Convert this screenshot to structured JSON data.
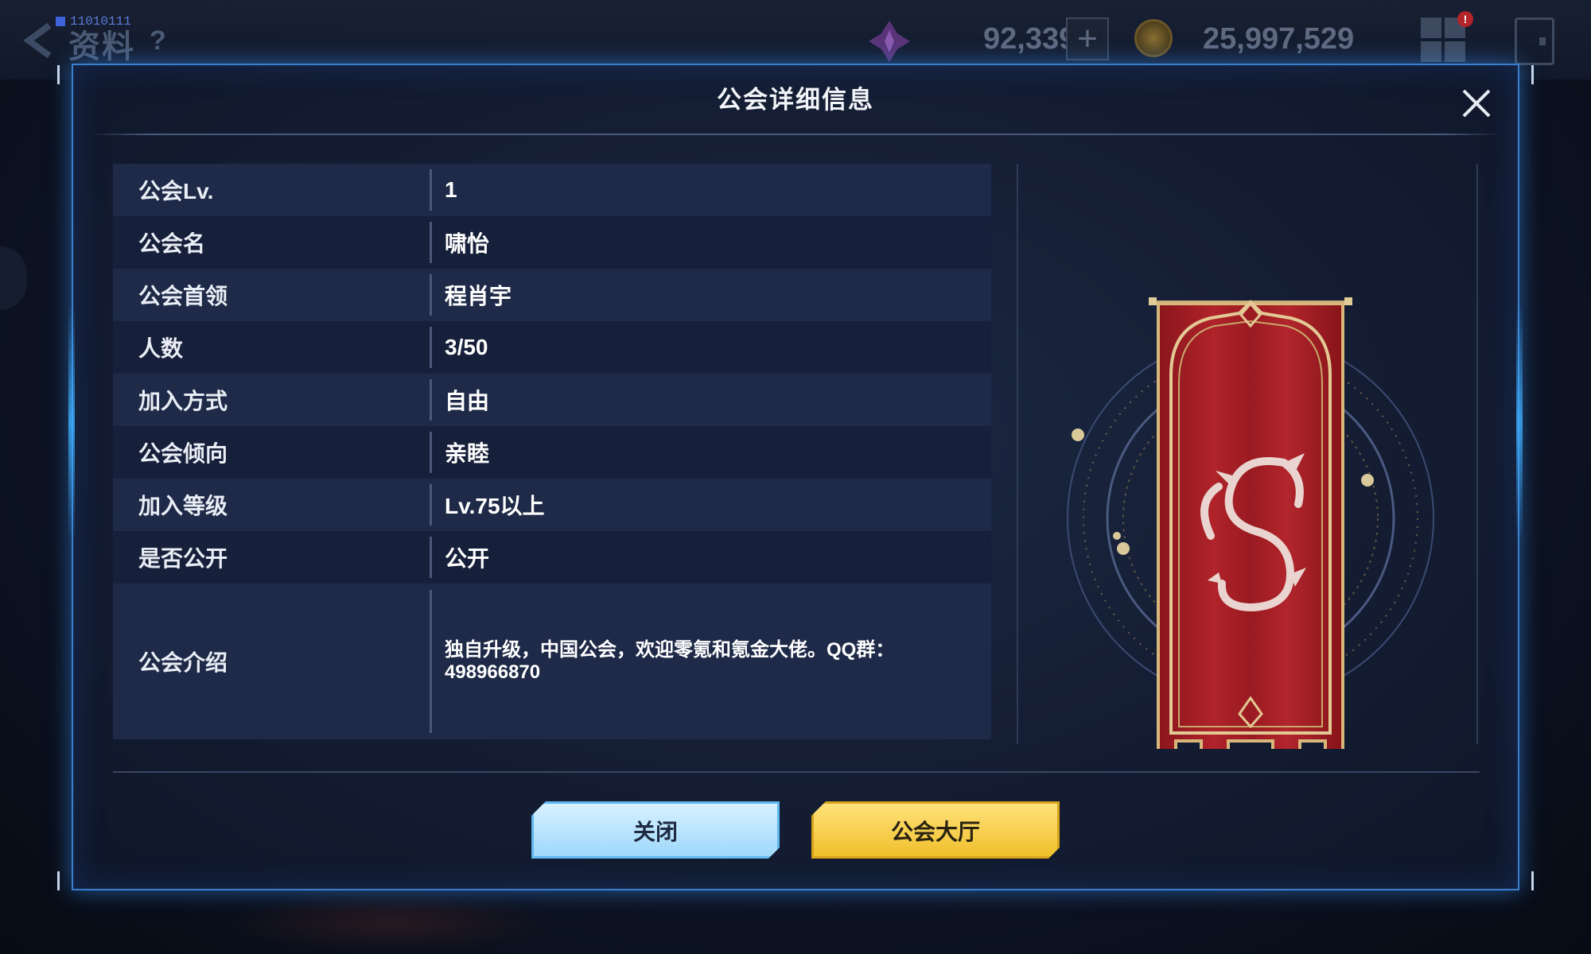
{
  "background": {
    "binary_tag": "11010111",
    "page_title": "资料",
    "help": "?",
    "gem_value": "92,339",
    "plus": "+",
    "coin_value": "25,997,529",
    "badge": "!"
  },
  "modal": {
    "title": "公会详细信息",
    "rows": [
      {
        "label": "公会Lv.",
        "value": "1"
      },
      {
        "label": "公会名",
        "value": "啸怡"
      },
      {
        "label": "公会首领",
        "value": "程肖宇"
      },
      {
        "label": "人数",
        "value": "3/50"
      },
      {
        "label": "加入方式",
        "value": "自由"
      },
      {
        "label": "公会倾向",
        "value": "亲睦"
      },
      {
        "label": "加入等级",
        "value": "Lv.75以上"
      },
      {
        "label": "是否公开",
        "value": "公开"
      }
    ],
    "intro": {
      "label": "公会介绍",
      "value": "独自升级，中国公会，欢迎零氪和氪金大佬。QQ群：498966870"
    },
    "buttons": {
      "close": "关闭",
      "hall": "公会大厅"
    }
  },
  "colors": {
    "accent_border": "#3a7fd0",
    "button_close": "#a8dcfb",
    "button_hall": "#f4c93a",
    "banner_red": "#a61f26",
    "banner_gold": "#d8b77a"
  },
  "icons": {
    "back": "back-arrow-icon",
    "gem": "purple-gem-icon",
    "coin": "gold-coin-icon",
    "menu": "grid-menu-icon",
    "exit": "exit-door-icon",
    "close": "close-x-icon",
    "emblem": "red-dragon-banner-emblem"
  }
}
